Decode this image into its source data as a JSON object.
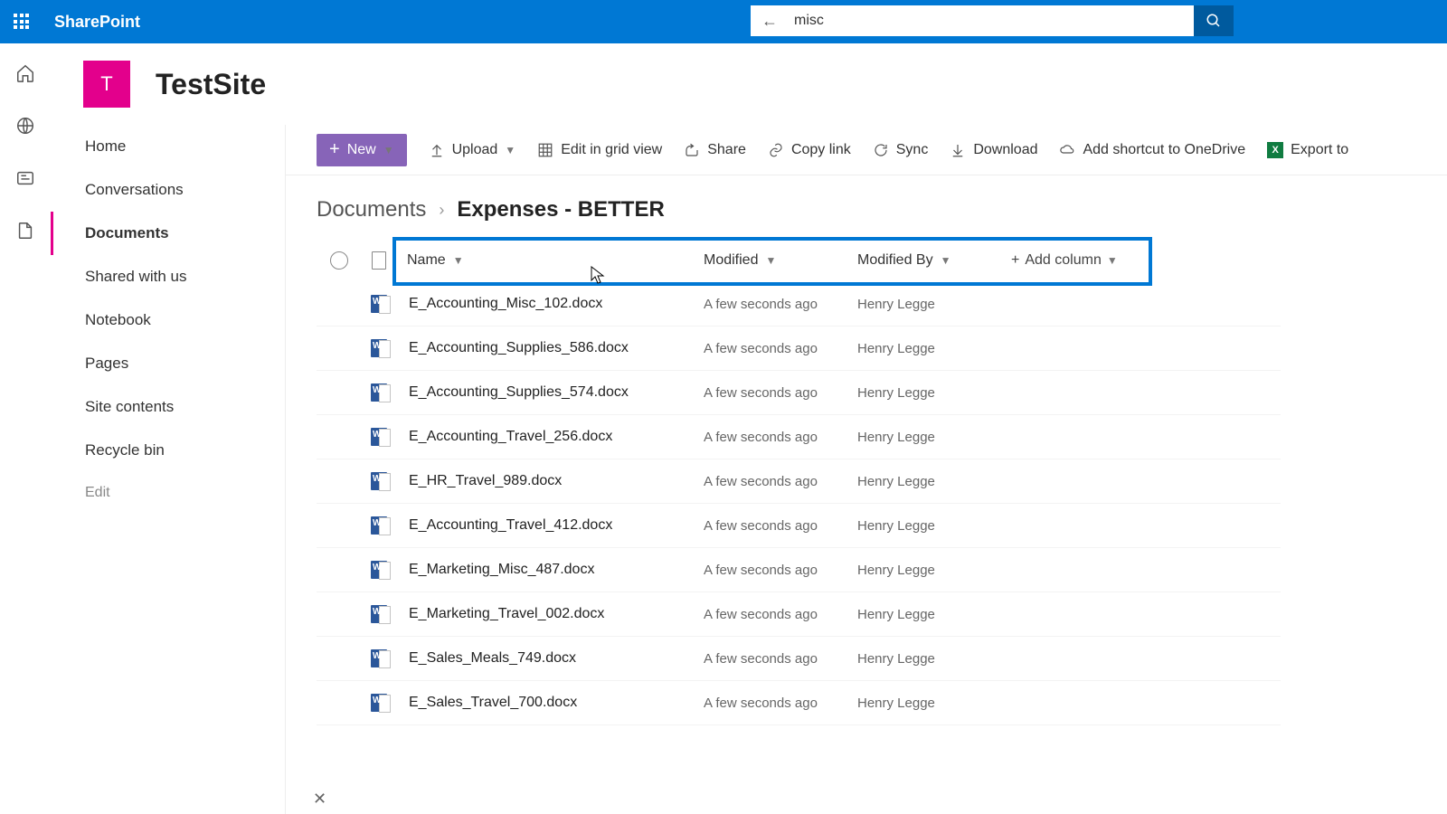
{
  "brand": "SharePoint",
  "search": {
    "value": "misc"
  },
  "site": {
    "initial": "T",
    "title": "TestSite"
  },
  "leftnav": {
    "items": [
      "Home",
      "Conversations",
      "Documents",
      "Shared with us",
      "Notebook",
      "Pages",
      "Site contents",
      "Recycle bin"
    ],
    "selected": 2,
    "edit": "Edit"
  },
  "cmdbar": {
    "new": "New",
    "upload": "Upload",
    "editgrid": "Edit in grid view",
    "share": "Share",
    "copylink": "Copy link",
    "sync": "Sync",
    "download": "Download",
    "shortcut": "Add shortcut to OneDrive",
    "export": "Export to"
  },
  "crumbs": {
    "root": "Documents",
    "current": "Expenses - BETTER"
  },
  "columns": {
    "name": "Name",
    "modified": "Modified",
    "modifiedby": "Modified By",
    "add": "Add column"
  },
  "rows": [
    {
      "name": "E_Accounting_Misc_102.docx",
      "modified": "A few seconds ago",
      "by": "Henry Legge"
    },
    {
      "name": "E_Accounting_Supplies_586.docx",
      "modified": "A few seconds ago",
      "by": "Henry Legge"
    },
    {
      "name": "E_Accounting_Supplies_574.docx",
      "modified": "A few seconds ago",
      "by": "Henry Legge"
    },
    {
      "name": "E_Accounting_Travel_256.docx",
      "modified": "A few seconds ago",
      "by": "Henry Legge"
    },
    {
      "name": "E_HR_Travel_989.docx",
      "modified": "A few seconds ago",
      "by": "Henry Legge"
    },
    {
      "name": "E_Accounting_Travel_412.docx",
      "modified": "A few seconds ago",
      "by": "Henry Legge"
    },
    {
      "name": "E_Marketing_Misc_487.docx",
      "modified": "A few seconds ago",
      "by": "Henry Legge"
    },
    {
      "name": "E_Marketing_Travel_002.docx",
      "modified": "A few seconds ago",
      "by": "Henry Legge"
    },
    {
      "name": "E_Sales_Meals_749.docx",
      "modified": "A few seconds ago",
      "by": "Henry Legge"
    },
    {
      "name": "E_Sales_Travel_700.docx",
      "modified": "A few seconds ago",
      "by": "Henry Legge"
    }
  ]
}
